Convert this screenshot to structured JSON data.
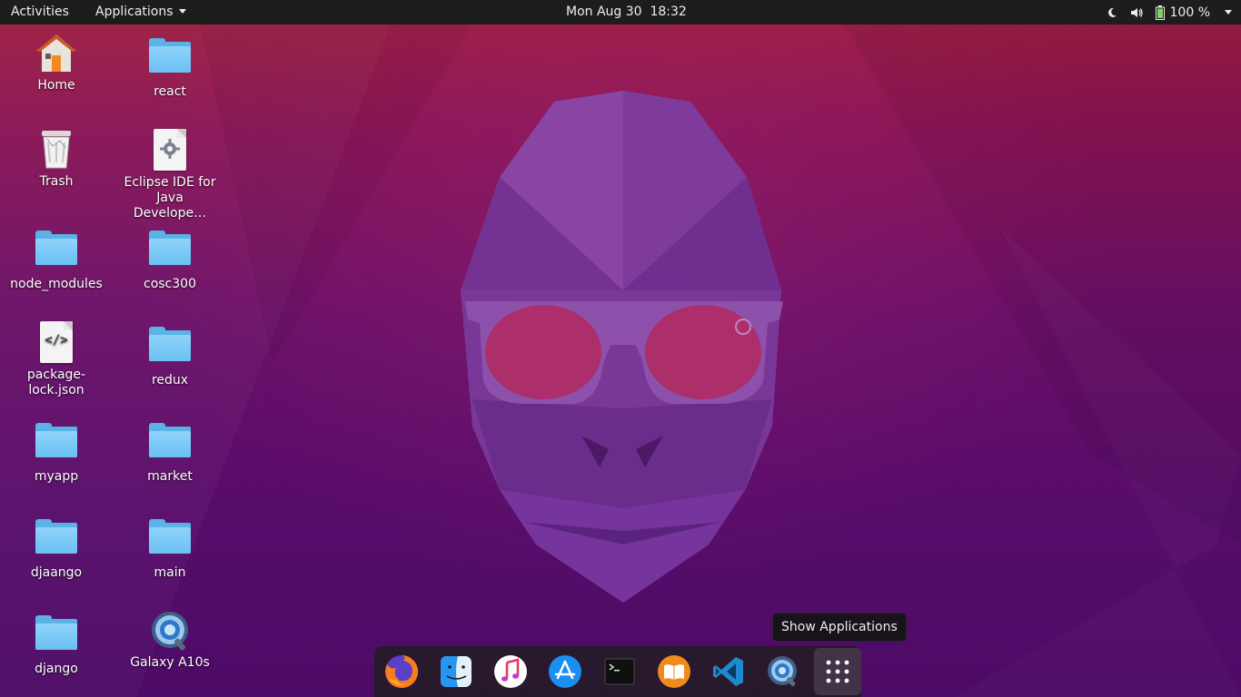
{
  "topbar": {
    "activities": "Activities",
    "applications": "Applications",
    "clock": "Mon Aug 30  18:32",
    "battery": "100 %"
  },
  "desktop_icons": [
    {
      "label": "Home",
      "icon": "home-icon"
    },
    {
      "label": "react",
      "icon": "folder-icon"
    },
    {
      "label": "Trash",
      "icon": "trash-icon"
    },
    {
      "label": "Eclipse IDE for Java Develope…",
      "icon": "settings-file-icon"
    },
    {
      "label": "node_modules",
      "icon": "folder-icon"
    },
    {
      "label": "cosc300",
      "icon": "folder-icon"
    },
    {
      "label": "package-lock.json",
      "icon": "code-file-icon"
    },
    {
      "label": "redux",
      "icon": "folder-icon"
    },
    {
      "label": "myapp",
      "icon": "folder-icon"
    },
    {
      "label": "market",
      "icon": "folder-icon"
    },
    {
      "label": "djaango",
      "icon": "folder-icon"
    },
    {
      "label": "main",
      "icon": "folder-icon"
    },
    {
      "label": "django",
      "icon": "folder-icon"
    },
    {
      "label": "Galaxy A10s",
      "icon": "phone-device-icon"
    }
  ],
  "dock": {
    "items": [
      {
        "name": "firefox",
        "icon": "firefox-icon",
        "running": true
      },
      {
        "name": "files",
        "icon": "finder-icon",
        "running": true
      },
      {
        "name": "music",
        "icon": "music-icon",
        "running": false
      },
      {
        "name": "software",
        "icon": "app-store-icon",
        "running": false
      },
      {
        "name": "terminal",
        "icon": "terminal-icon",
        "running": false
      },
      {
        "name": "books",
        "icon": "books-icon",
        "running": true
      },
      {
        "name": "vscode",
        "icon": "vscode-icon",
        "running": true
      },
      {
        "name": "device",
        "icon": "device-icon",
        "running": false
      },
      {
        "name": "show-applications",
        "icon": "grid-icon",
        "running": false
      }
    ],
    "tooltip": "Show Applications"
  },
  "colors": {
    "accent": "#e95420",
    "folder": "#6ac0f2",
    "topbar": "#1d1d1d"
  }
}
